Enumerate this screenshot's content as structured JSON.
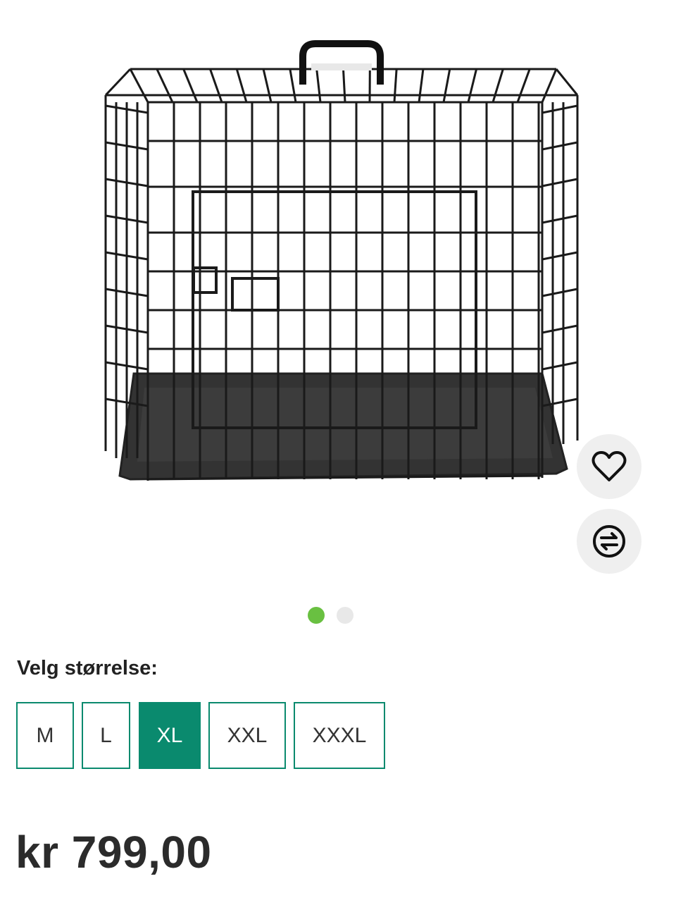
{
  "product": {
    "image_alt": "dog crate",
    "favorite_icon": "heart-icon",
    "compare_icon": "compare-arrows-icon"
  },
  "carousel": {
    "count": 2,
    "active_index": 0,
    "active_color": "#69c041"
  },
  "size_selector": {
    "label": "Velg størrelse:",
    "options": [
      "M",
      "L",
      "XL",
      "XXL",
      "XXXL"
    ],
    "selected": "XL",
    "accent_color": "#0a8a6e"
  },
  "price": {
    "text": "kr 799,00"
  }
}
